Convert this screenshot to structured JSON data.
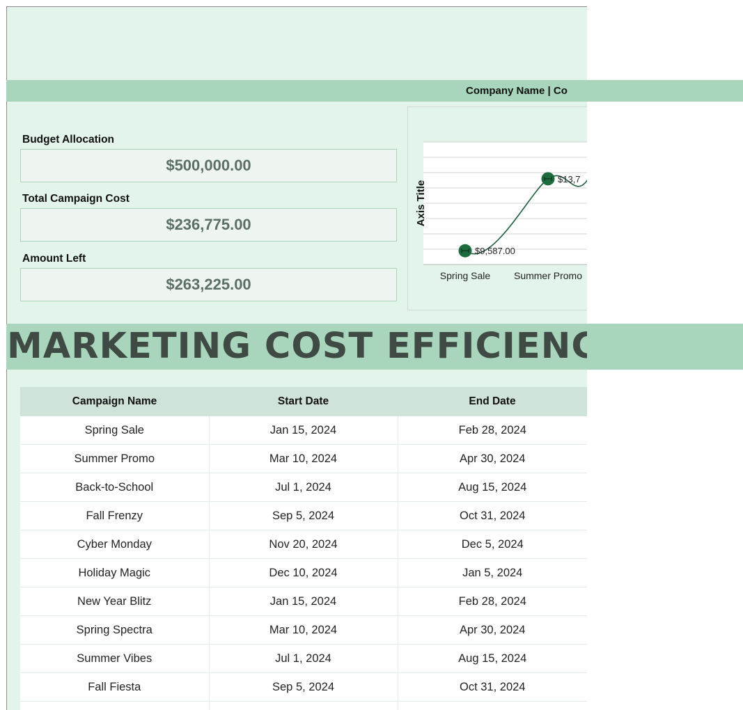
{
  "header": {
    "company_text": "Company Name | Co",
    "main_title": "MARKETING COST EFFICIENCY"
  },
  "metrics": [
    {
      "label": "Budget Allocation",
      "value": "$500,000.00"
    },
    {
      "label": "Total Campaign Cost",
      "value": "$236,775.00"
    },
    {
      "label": "Amount Left",
      "value": "$263,225.00"
    }
  ],
  "chart_data": {
    "type": "line",
    "ylabel": "Axis Title",
    "categories": [
      "Spring Sale",
      "Summer Promo"
    ],
    "series": [
      {
        "values": [
          9587,
          13700
        ],
        "labels": [
          "$9,587.00",
          "$13,7"
        ]
      }
    ],
    "grid": true,
    "colors": {
      "line": "#1e5c3a",
      "marker": "#1e6b3e"
    }
  },
  "table": {
    "columns": [
      "Campaign Name",
      "Start Date",
      "End Date"
    ],
    "rows": [
      [
        "Spring Sale",
        "Jan 15, 2024",
        "Feb 28, 2024"
      ],
      [
        "Summer Promo",
        "Mar 10, 2024",
        "Apr 30, 2024"
      ],
      [
        "Back-to-School",
        "Jul 1, 2024",
        "Aug 15, 2024"
      ],
      [
        "Fall Frenzy",
        "Sep 5, 2024",
        "Oct 31, 2024"
      ],
      [
        "Cyber Monday",
        "Nov 20, 2024",
        "Dec 5, 2024"
      ],
      [
        "Holiday Magic",
        "Dec 10, 2024",
        "Jan 5, 2024"
      ],
      [
        "New Year Blitz",
        "Jan 15, 2024",
        "Feb 28, 2024"
      ],
      [
        "Spring Spectra",
        "Mar 10, 2024",
        "Apr 30, 2024"
      ],
      [
        "Summer Vibes",
        "Jul 1, 2024",
        "Aug 15, 2024"
      ],
      [
        "Fall Fiesta",
        "Sep 5, 2024",
        "Oct 31, 2024"
      ],
      [
        "",
        "",
        ""
      ]
    ]
  },
  "colors": {
    "sheet_background": "#e3f4ea",
    "accent_band": "#a8d5bb",
    "header_row": "#cfe3d8",
    "title_text": "#3f4a45"
  }
}
